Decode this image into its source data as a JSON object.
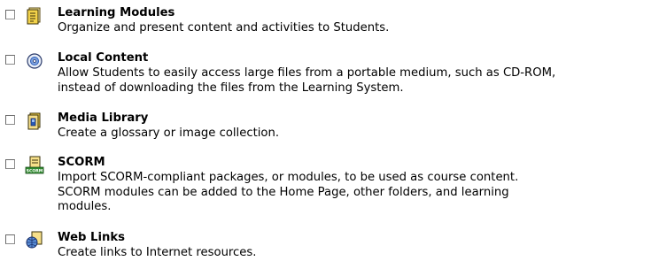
{
  "tools": [
    {
      "title": "Learning Modules",
      "icon": "learning-modules-icon",
      "description_lines": [
        "Organize and present content and activities to Students."
      ]
    },
    {
      "title": "Local Content",
      "icon": "cd-rom-icon",
      "description_lines": [
        "Allow Students to easily access large files from a portable medium, such as CD-ROM,",
        "instead of downloading the files from the Learning System."
      ]
    },
    {
      "title": "Media Library",
      "icon": "media-library-icon",
      "description_lines": [
        "Create a glossary or image collection."
      ]
    },
    {
      "title": "SCORM",
      "icon": "scorm-package-icon",
      "icon_label": "SCORM",
      "description_lines": [
        "Import SCORM-compliant packages, or modules, to be used as course content.",
        "SCORM modules can be added to the Home Page, other folders, and learning",
        "modules."
      ]
    },
    {
      "title": "Web Links",
      "icon": "web-links-icon",
      "description_lines": [
        "Create links to Internet resources."
      ]
    }
  ],
  "colors": {
    "checkbox_border": "#8c8c8c",
    "icon_yellow": "#f2d24a",
    "icon_blue": "#2a5bb8",
    "icon_green": "#2e8b2e"
  }
}
